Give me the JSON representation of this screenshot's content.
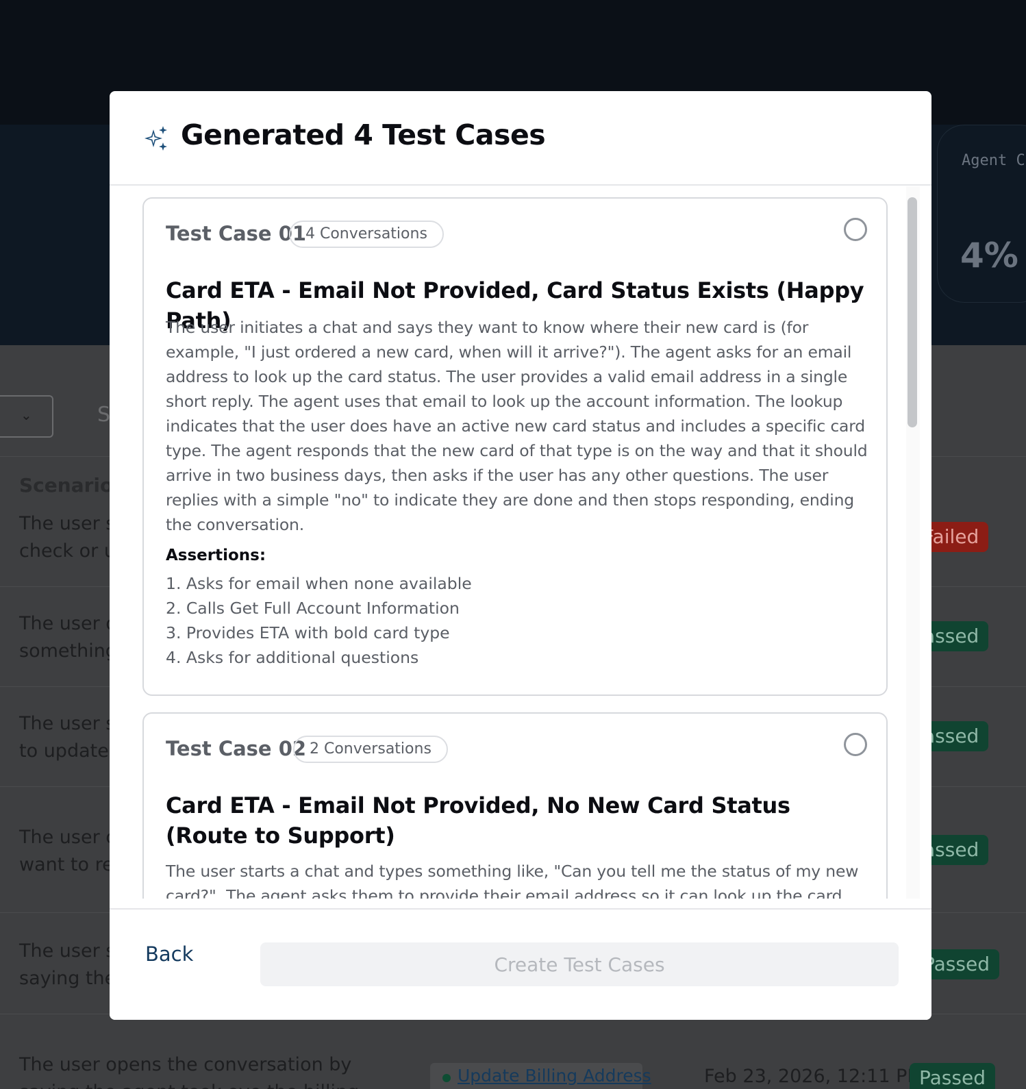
{
  "background": {
    "agent_card_label": "Agent C",
    "agent_card_value": "4%",
    "search_hint": "S",
    "scenario_header": "Scenario",
    "rows": [
      {
        "text": "The user st\ncheck or u",
        "status": "Failed"
      },
      {
        "text": "The user o\nsomething",
        "status": "assed"
      },
      {
        "text": "The user st\nto update",
        "status": "assed"
      },
      {
        "text": "The user c\nwant to re",
        "status": "assed"
      },
      {
        "text": "The user st\nsaying the",
        "status": "Passed"
      },
      {
        "text": "The user opens the conversation by\nsaying the agent took ove the billing",
        "status": "Passed"
      }
    ],
    "last_row_tag": "Update Billing Address",
    "last_row_date": "Feb 23, 2026, 12:11 PM"
  },
  "modal": {
    "icon": "sparkle-icon",
    "title": "Generated 4 Test Cases",
    "test_cases": [
      {
        "label": "Test Case 01",
        "conversations": "4 Conversations",
        "title": "Card ETA - Email Not Provided, Card Status Exists (Happy Path)",
        "description": "The user initiates a chat and says they want to know where their new card is (for example, \"I just ordered a new card, when will it arrive?\"). The agent asks for an email address to look up the card status. The user provides a valid email address in a single short reply. The agent uses that email to look up the account information. The lookup indicates that the user does have an active new card status and includes a specific card type. The agent responds that the new card of that type is on the way and that it should arrive in two business days, then asks if the user has any other questions. The user replies with a simple \"no\" to indicate they are done and then stops responding, ending the conversation.",
        "assertions_header": "Assertions:",
        "assertions": [
          "1. Asks for email when none available",
          "2. Calls Get Full Account Information",
          "3. Provides ETA with bold card type",
          "4. Asks for additional questions"
        ]
      },
      {
        "label": "Test Case 02",
        "conversations": "2 Conversations",
        "title": "Card ETA - Email Not Provided, No New Card Status (Route to Support)",
        "description": "The user starts a chat and types something like, \"Can you tell me the status of my new card?\". The agent asks them to provide their email address so it can look up the card. The user replies"
      }
    ],
    "back_label": "Back",
    "create_label": "Create Test Cases"
  }
}
